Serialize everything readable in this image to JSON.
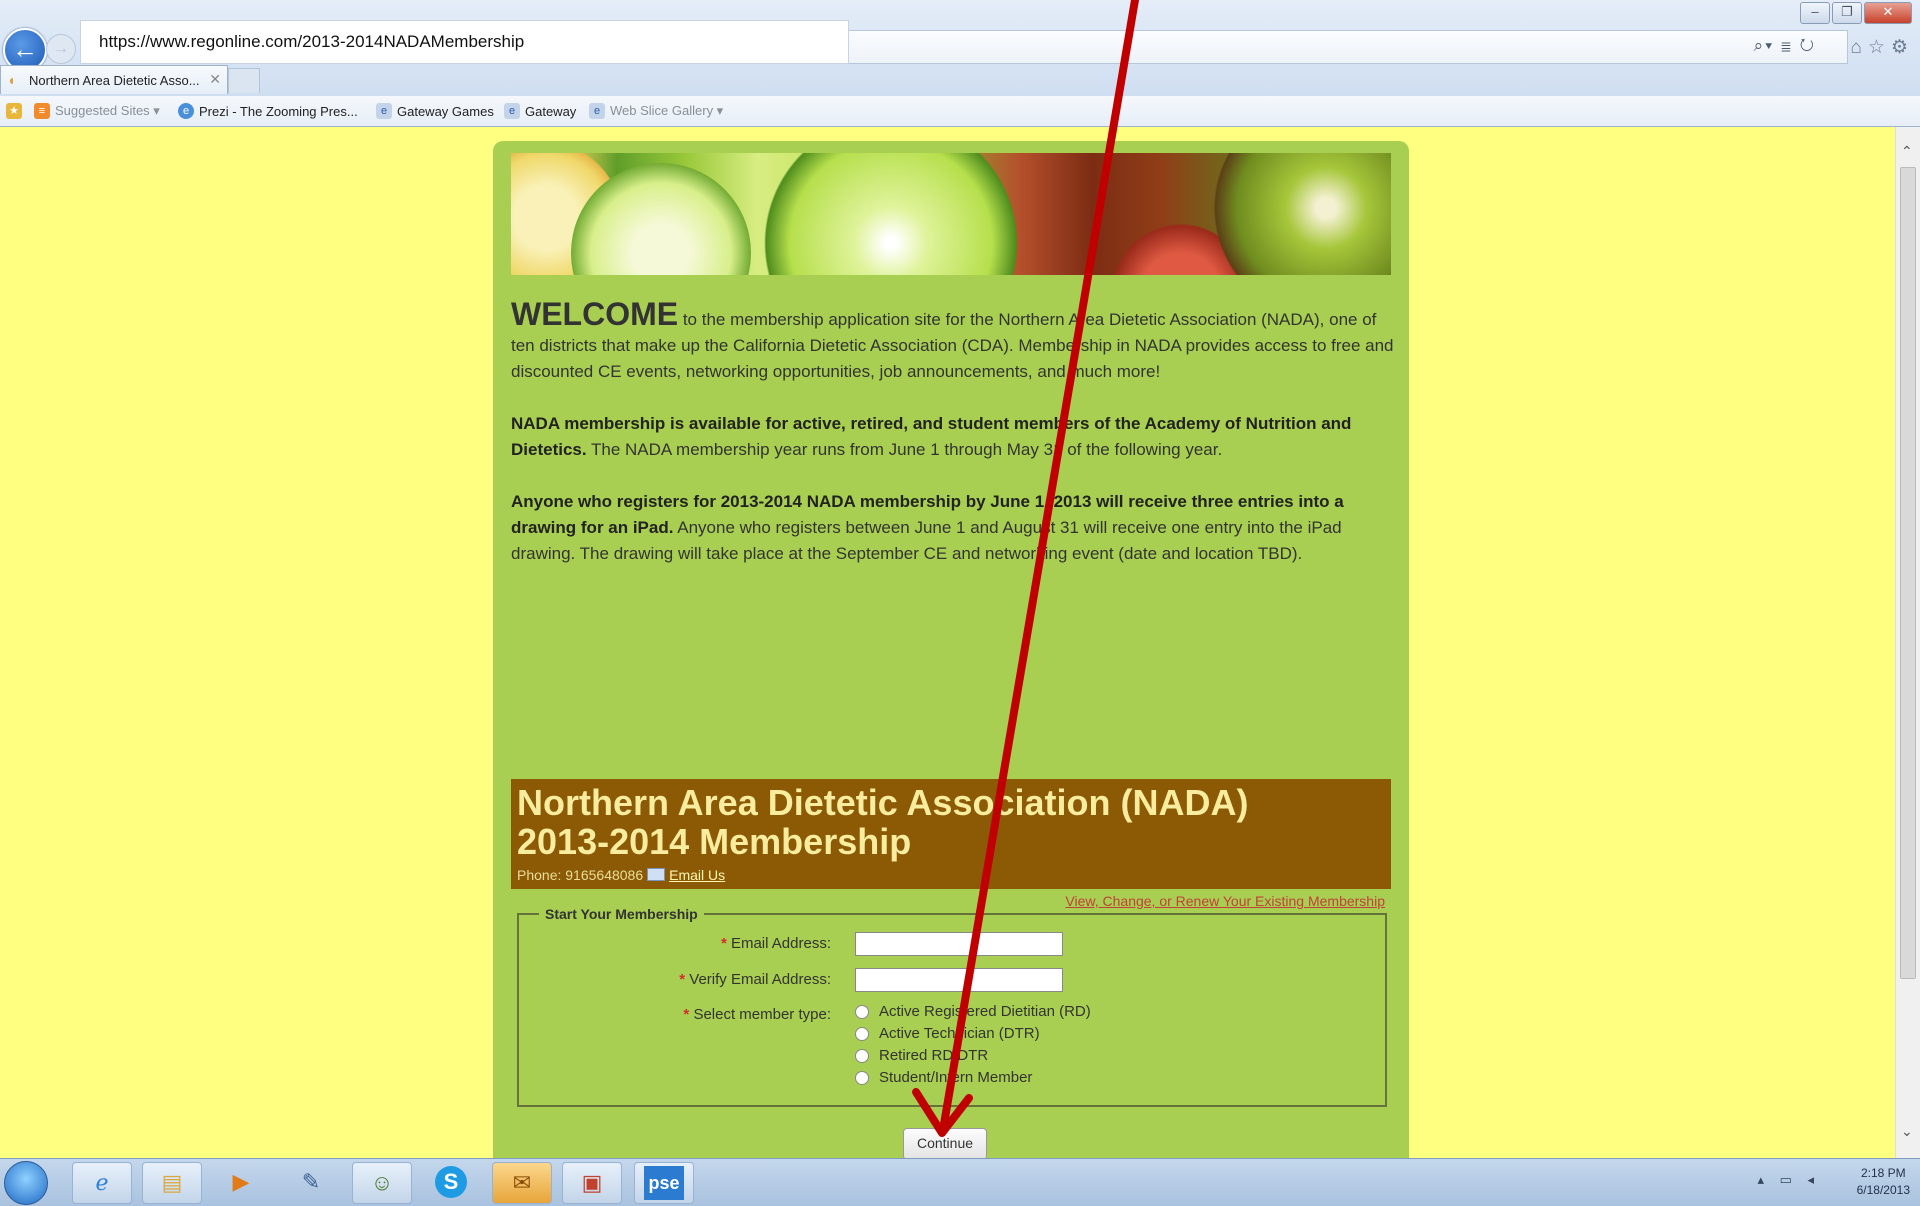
{
  "browser": {
    "url": "https://www.regonline.com/2013-2014NADAMembership",
    "tab_title": "Northern Area Dietetic Asso...",
    "favorites": [
      {
        "label": "Suggested Sites ▾",
        "icon": "suggested-sites-icon"
      },
      {
        "label": "Prezi - The Zooming Pres...",
        "icon": "prezi-icon"
      },
      {
        "label": "Gateway Games",
        "icon": "page-icon"
      },
      {
        "label": "Gateway",
        "icon": "page-icon"
      },
      {
        "label": "Web Slice Gallery ▾",
        "icon": "web-slice-icon"
      }
    ]
  },
  "page": {
    "welcome_word": "WELCOME",
    "welcome_rest": " to the membership application site for the Northern Area Dietetic Association (NADA), one of ten districts that make up the California Dietetic Association (CDA). Membership in NADA provides access to free and discounted CE events, networking opportunities, job announcements, and much more!",
    "p2_bold": "NADA membership is available for active, retired, and student members of the Academy of Nutrition and Dietetics.",
    "p2_rest": " The NADA membership year runs from June 1 through May 31 of the following year.",
    "p3_bold": "Anyone who registers for 2013-2014 NADA membership by June 1, 2013 will receive three entries into a drawing for an iPad.",
    "p3_rest": " Anyone who registers between June 1 and August 31 will receive one entry into the iPad drawing. The drawing will take place at the September CE and networking event (date and location TBD).",
    "title_line1": "Northern Area Dietetic Association (NADA)",
    "title_line2": "2013-2014 Membership",
    "phone": "Phone: 9165648086",
    "email_link": "Email Us",
    "existing_link": "View, Change, or Renew Your Existing Membership"
  },
  "form": {
    "legend": "Start Your Membership",
    "email_label": "Email Address:",
    "verify_label": "Verify Email Address:",
    "email_value": "",
    "verify_value": "",
    "member_type_label": "Select member type:",
    "member_types": [
      "Active Registered Dietitian (RD)",
      "Active Technician (DTR)",
      "Retired RD/DTR",
      "Student/Intern Member"
    ],
    "continue_label": "Continue"
  },
  "taskbar": {
    "time": "2:18 PM",
    "date": "6/18/2013",
    "apps": [
      "start-orb-icon",
      "internet-explorer-icon",
      "file-explorer-icon",
      "media-player-icon",
      "paint-icon",
      "people-icon",
      "skype-icon",
      "outlook-icon",
      "powerpoint-icon",
      "pse-icon"
    ],
    "pse_label": "pse"
  },
  "annotation": {
    "color": "#c00000"
  }
}
